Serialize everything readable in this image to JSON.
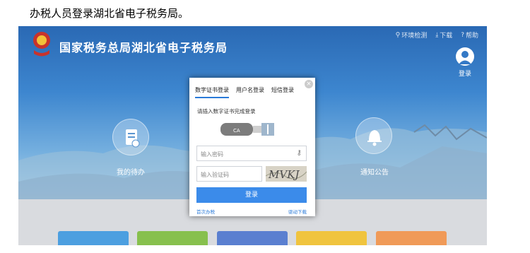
{
  "caption": "办税人员登录湖北省电子税务局。",
  "header": {
    "site_title": "国家税务总局湖北省电子税务局",
    "links": [
      "环境检测",
      "下载",
      "帮助"
    ],
    "login_label": "登录"
  },
  "shortcuts": {
    "left_label": "我的待办",
    "right_label": "通知公告"
  },
  "dialog": {
    "tabs": [
      "数字证书登录",
      "用户名登录",
      "短信登录"
    ],
    "active_tab": "数字证书登录",
    "hint": "请插入数字证书完成登录",
    "usb_label": "CA",
    "password_placeholder": "输入密码",
    "captcha_placeholder": "输入验证码",
    "captcha_text": "MVKJ",
    "login_button": "登录",
    "first_time_link": "首次办税",
    "driver_download_link": "驱动下载"
  },
  "colors": {
    "accent": "#3b8bea",
    "tab_underline": "#2a7ad8"
  },
  "tile_colors": [
    "#4c9fe0",
    "#87c04d",
    "#5a7fd0",
    "#f0c43e",
    "#f09a58"
  ]
}
